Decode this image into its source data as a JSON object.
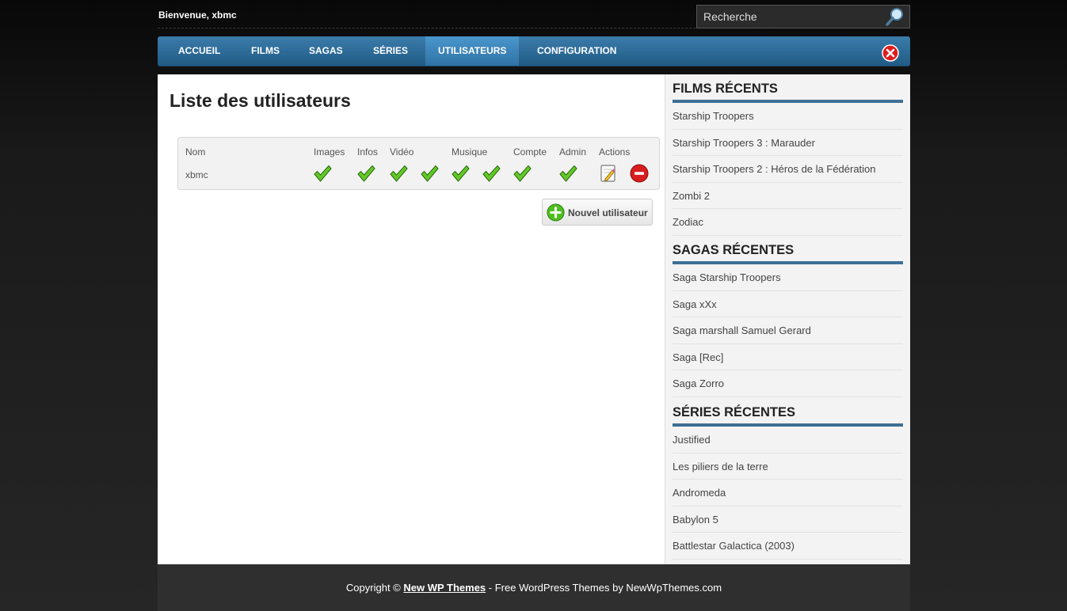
{
  "header": {
    "welcome": "Bienvenue, xbmc",
    "search_placeholder": "Recherche"
  },
  "nav": [
    {
      "label": "ACCUEIL"
    },
    {
      "label": "FILMS"
    },
    {
      "label": "SAGAS"
    },
    {
      "label": "SÉRIES"
    },
    {
      "label": "UTILISATEURS",
      "active": true
    },
    {
      "label": "CONFIGURATION"
    }
  ],
  "main": {
    "title": "Liste des utilisateurs",
    "table": {
      "headers": [
        "Nom",
        "Images",
        "Infos",
        "Vidéo",
        "Musique",
        "Compte",
        "Admin",
        "Actions"
      ],
      "rows": [
        {
          "name": "xbmc",
          "checks": 8,
          "actions": [
            "edit-icon",
            "delete-icon"
          ]
        }
      ]
    },
    "new_user_label": "Nouvel utilisateur"
  },
  "sidebar": {
    "films": {
      "title": "FILMS RÉCENTS",
      "items": [
        "Starship Troopers",
        "Starship Troopers 3 : Marauder",
        "Starship Troopers 2 : Héros de la Fédération",
        "Zombi 2",
        "Zodiac"
      ]
    },
    "sagas": {
      "title": "SAGAS RÉCENTES",
      "items": [
        "Saga Starship Troopers",
        "Saga xXx",
        "Saga marshall Samuel Gerard",
        "Saga [Rec]",
        "Saga Zorro"
      ]
    },
    "series": {
      "title": "SÉRIES RÉCENTES",
      "items": [
        "Justified",
        "Les piliers de la terre",
        "Andromeda",
        "Babylon 5",
        "Battlestar Galactica (2003)"
      ]
    }
  },
  "footer": {
    "prefix": "Copyright ©",
    "link": "New WP Themes",
    "suffix": "- Free WordPress Themes by NewWpThemes.com"
  },
  "colors": {
    "nav_blue": "#2f6d9b",
    "accent_underline": "#3d6f95",
    "check_green": "#4fbf1f",
    "delete_red": "#d81e1e"
  }
}
